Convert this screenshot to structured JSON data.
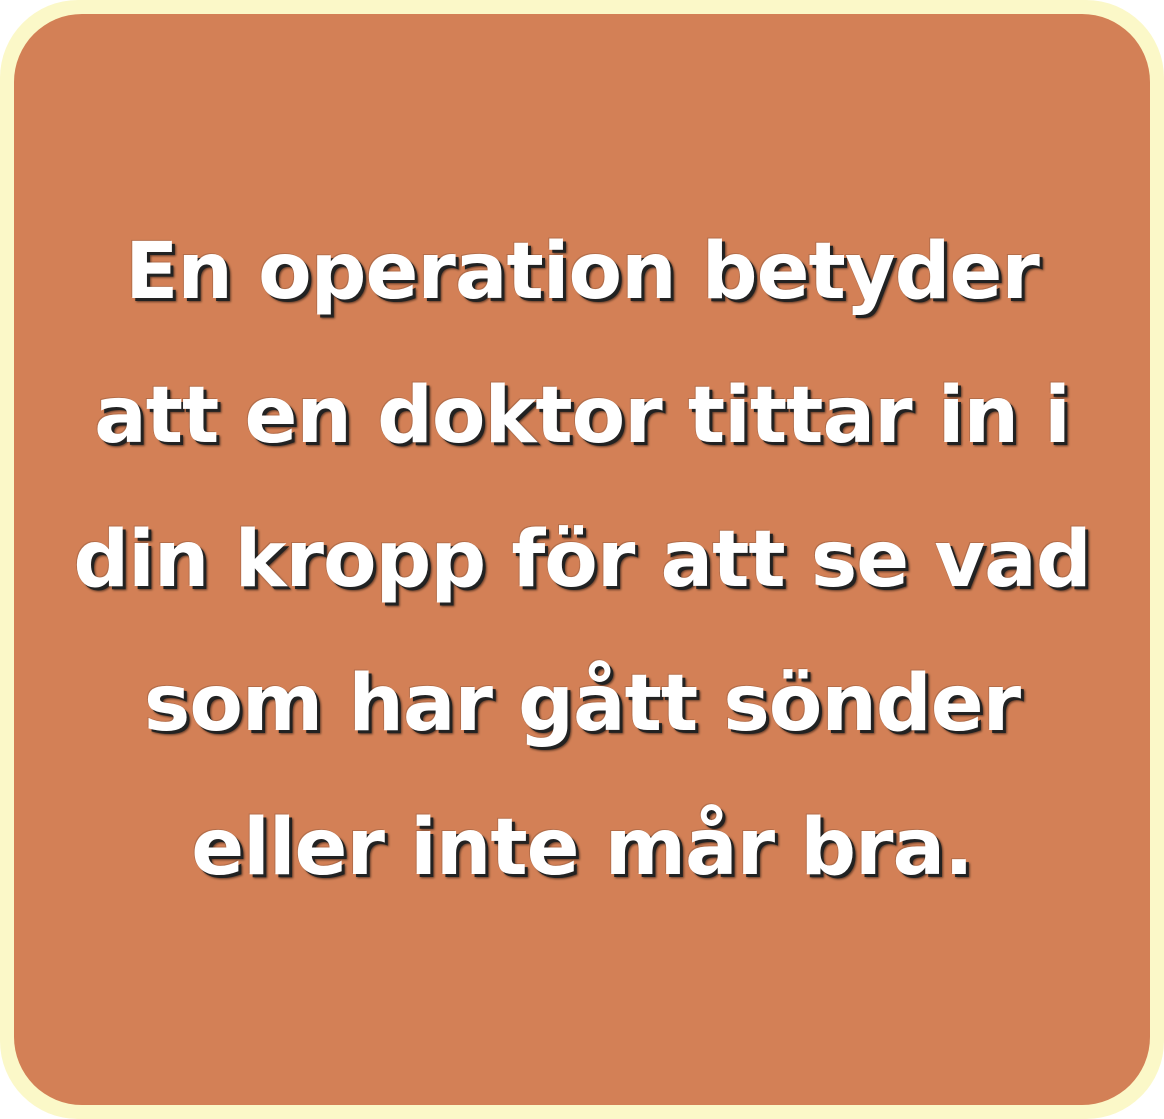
{
  "card": {
    "lines": [
      "En operation betyder",
      "att en doktor tittar in i",
      "din kropp för att se vad",
      "som har gått sönder",
      "eller inte mår bra."
    ]
  },
  "colors": {
    "frame": "#fbf8c8",
    "card": "#d38056",
    "text": "#ffffff",
    "shadow": "#222222"
  }
}
